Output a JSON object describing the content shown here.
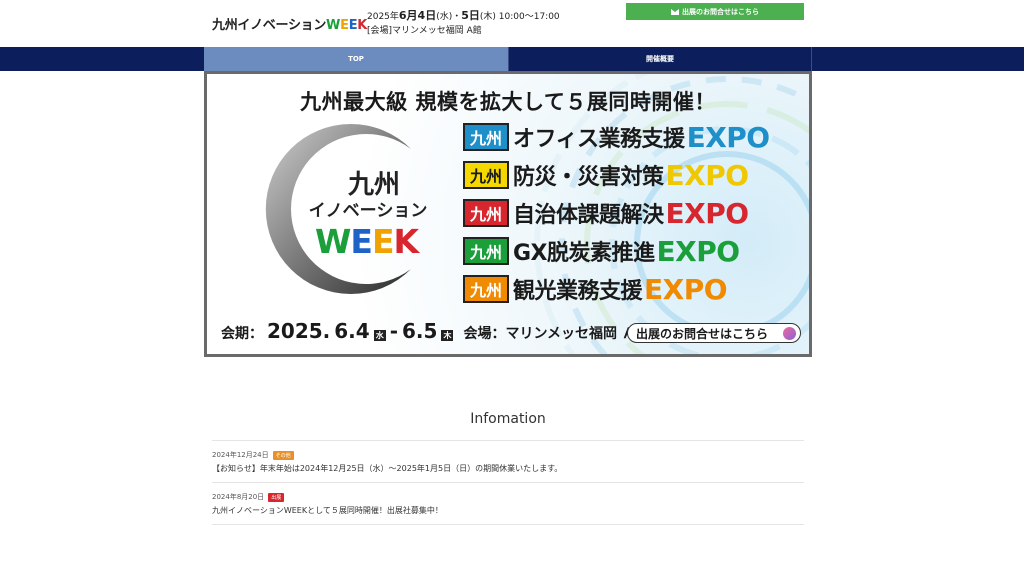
{
  "header": {
    "logo_text": "九州イノベーション",
    "logo_week": [
      "W",
      "E",
      "E",
      "K"
    ],
    "date_prefix": "2025年",
    "date_main": "6月4日",
    "date_day1": "(水)・",
    "date_main2": "5日",
    "date_day2": "(木) 10:00〜17:00",
    "venue_line": "[会場]マリンメッセ福岡 A館",
    "contact_label": "出展のお問合せはこちら"
  },
  "nav": {
    "tabs": [
      {
        "label": "TOP"
      },
      {
        "label": "開催概要"
      }
    ]
  },
  "banner": {
    "headline": "九州最大級 規模を拡大して５展同時開催！",
    "week_line1": "九州",
    "week_line2": "イノベーション",
    "week_letters": [
      "W",
      "E",
      "E",
      "K"
    ],
    "expos": [
      {
        "tag": "九州",
        "name": "オフィス業務支援",
        "suffix": "EXPO",
        "tag_color": "#1e8fc8",
        "suffix_color": "#1e8fc8"
      },
      {
        "tag": "九州",
        "name": "防災・災害対策",
        "suffix": "EXPO",
        "tag_color": "#f5d800",
        "suffix_color": "#f0c800"
      },
      {
        "tag": "九州",
        "name": "自治体課題解決",
        "suffix": "EXPO",
        "tag_color": "#d7262e",
        "suffix_color": "#d7262e"
      },
      {
        "tag": "九州",
        "name": "GX脱炭素推進",
        "suffix": "EXPO",
        "tag_color": "#1a9f3a",
        "suffix_color": "#1a9f3a"
      },
      {
        "tag": "九州",
        "name": "観光業務支援",
        "suffix": "EXPO",
        "tag_color": "#f08a00",
        "suffix_color": "#f08a00"
      }
    ],
    "period_label": "会期：",
    "period_year": "2025.",
    "period_start": "6.4",
    "day1": "水",
    "dash": "-",
    "period_end": "6.5",
    "day2": "木",
    "venue_label": "会場：マリンメッセ福岡 Ａ館",
    "cta": "出展のお問合せはこちら"
  },
  "info": {
    "title": "Infomation",
    "news": [
      {
        "date": "2024年12月24日",
        "badge": "その他",
        "badge_color": "#e8912b",
        "text": "【お知らせ】年末年始は2024年12月25日（水）〜2025年1月5日（日）の期間休業いたします。"
      },
      {
        "date": "2024年8月20日",
        "badge": "出展",
        "badge_color": "#d7262e",
        "text": "九州イノベーションWEEKとして５展同時開催！出展社募集中！"
      }
    ]
  }
}
